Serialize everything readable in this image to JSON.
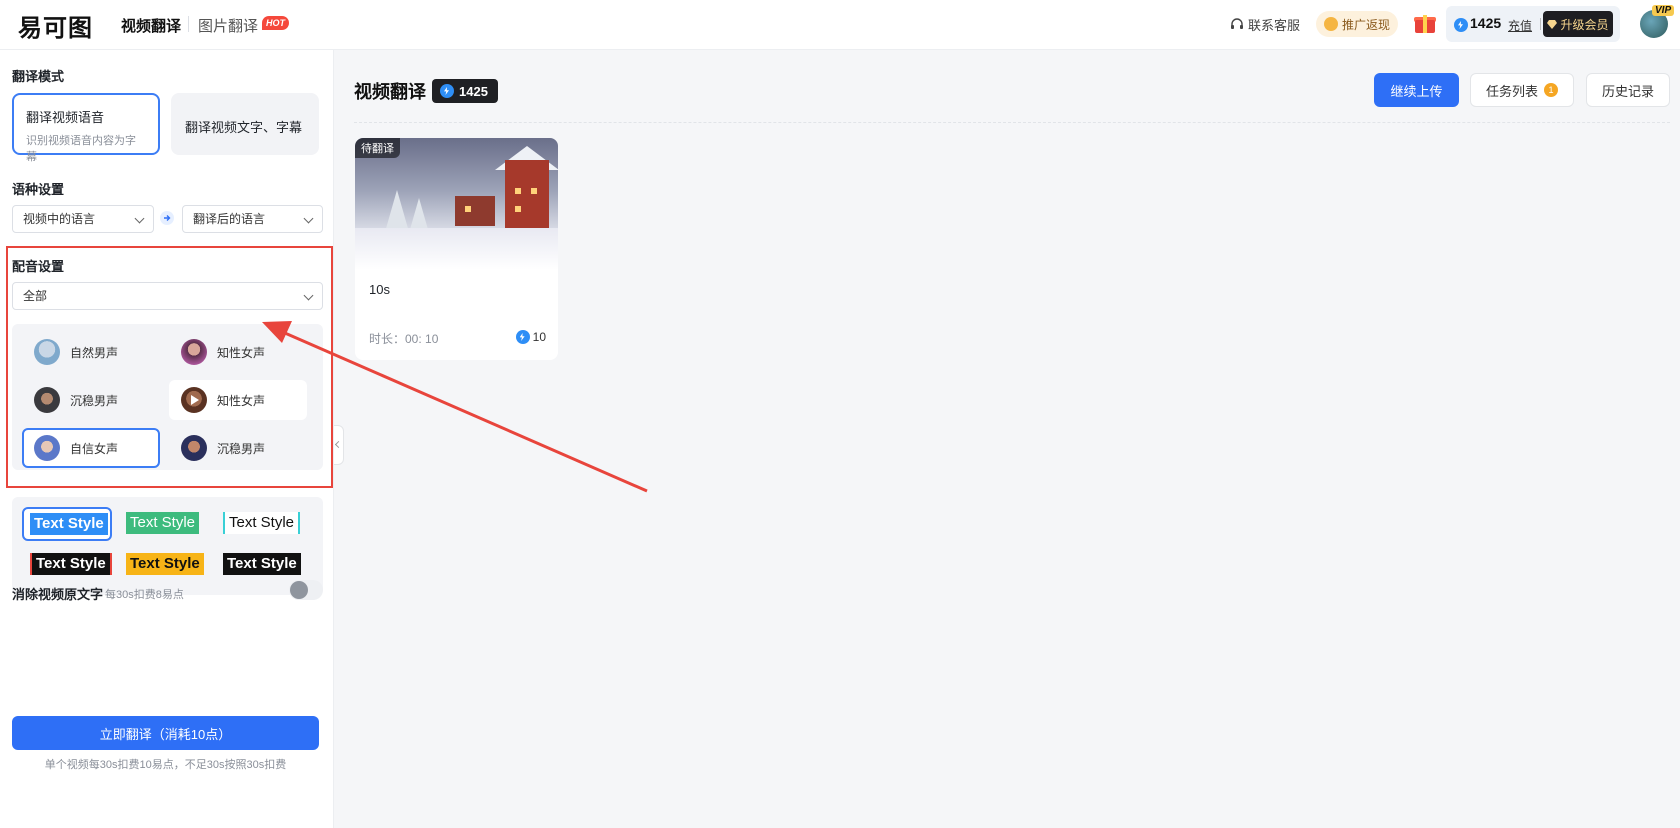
{
  "header": {
    "logo": "易可图",
    "nav_video": "视频翻译",
    "nav_image": "图片翻译",
    "hot": "HOT",
    "service": "联系客服",
    "promo": "推广返现",
    "credits": "1425",
    "recharge": "充值",
    "upgrade": "升级会员",
    "vip": "VIP"
  },
  "sidebar": {
    "mode_title": "翻译模式",
    "modes": [
      {
        "title": "翻译视频语音",
        "sub": "识别视频语音内容为字幕"
      },
      {
        "title": "翻译视频文字、字幕"
      }
    ],
    "lang_title": "语种设置",
    "source_lang": "视频中的语言",
    "target_lang": "翻译后的语言",
    "dub_title": "配音设置",
    "dub_filter": "全部",
    "voices": [
      {
        "label": "自然男声"
      },
      {
        "label": "知性女声"
      },
      {
        "label": "沉稳男声"
      },
      {
        "label": "知性女声"
      },
      {
        "label": "自信女声"
      },
      {
        "label": "沉稳男声"
      }
    ],
    "text_styles": [
      "Text Style",
      "Text Style",
      "Text Style",
      "Text Style",
      "Text Style",
      "Text Style"
    ],
    "erase_label": "消除视频原文字",
    "erase_sub": "每30s扣费8易点",
    "translate_button": "立即翻译（消耗10点）",
    "foot_note": "单个视频每30s扣费10易点，不足30s按照30s扣费"
  },
  "main": {
    "title": "视频翻译",
    "credits": "1425",
    "upload": "继续上传",
    "tasks": "任务列表",
    "task_count": "1",
    "history": "历史记录",
    "videos": [
      {
        "status": "待翻译",
        "name": "10s",
        "duration": "时长：00: 10",
        "cost": "10"
      }
    ]
  },
  "colors": {
    "primary": "#2e6ff6",
    "highlight": "#e8453c",
    "hot": "#f5483b"
  }
}
